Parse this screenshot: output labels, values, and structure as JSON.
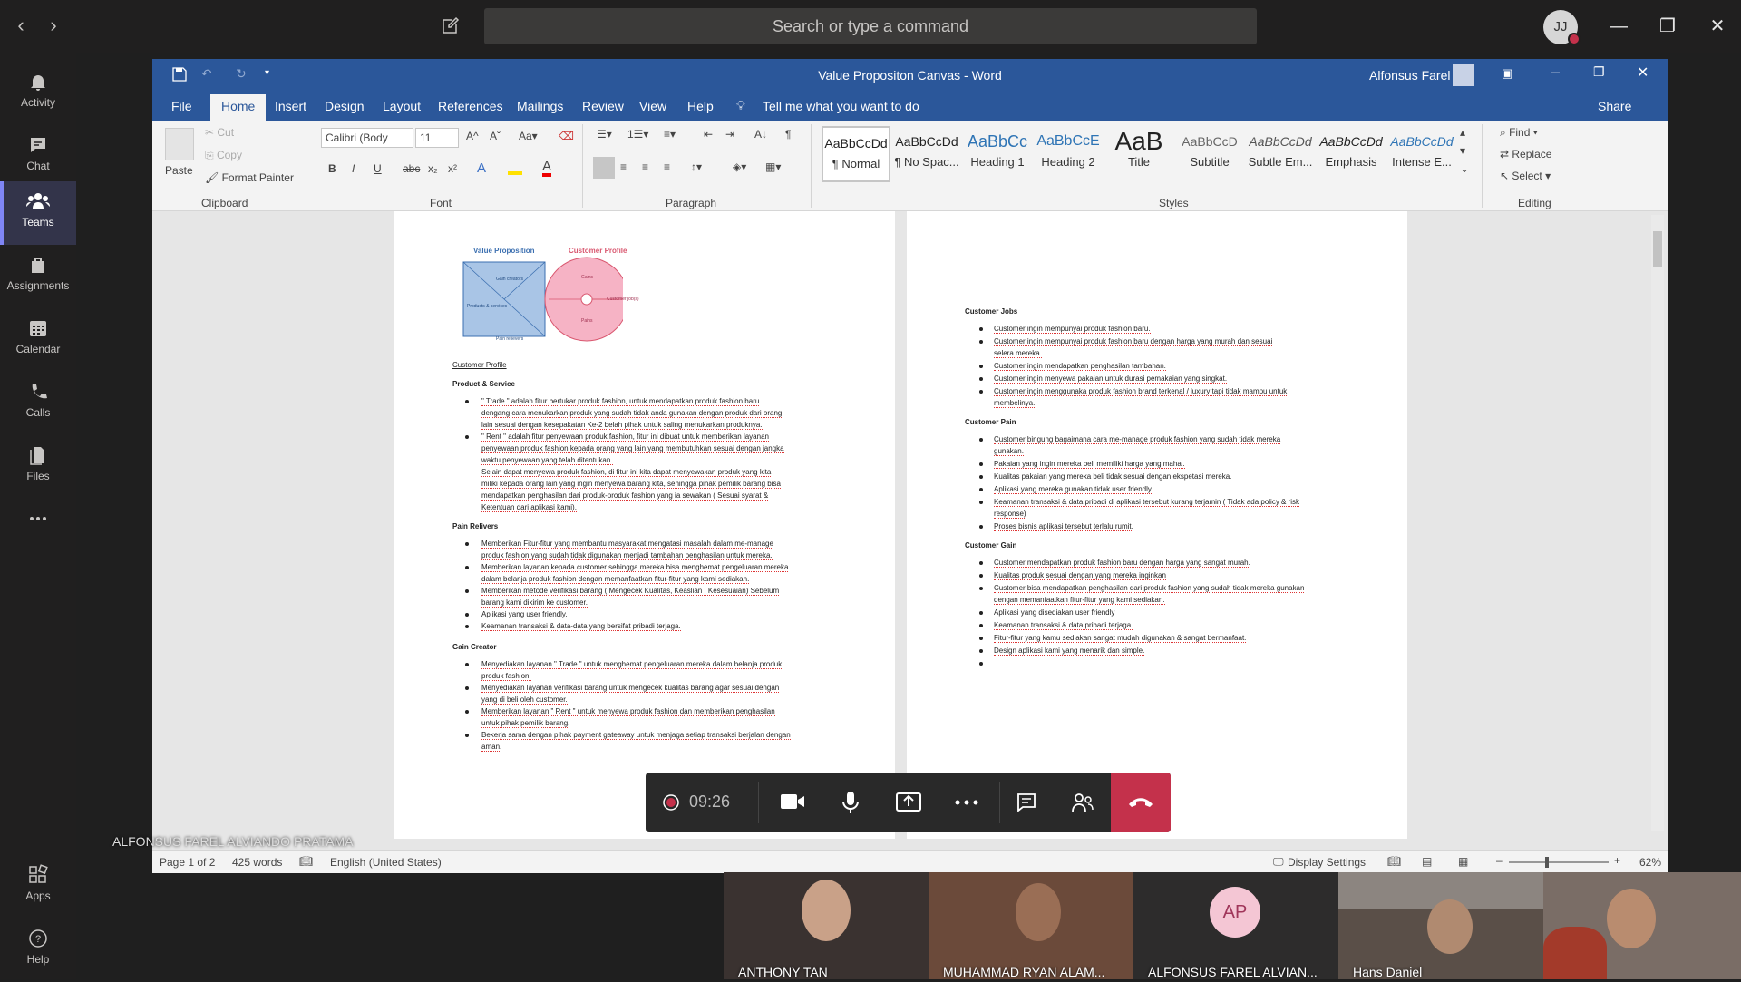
{
  "teams": {
    "search_placeholder": "Search or type a command",
    "avatar_initials": "JJ",
    "rail": [
      {
        "label": "Activity",
        "icon": "bell-icon"
      },
      {
        "label": "Chat",
        "icon": "chat-icon"
      },
      {
        "label": "Teams",
        "icon": "teams-icon"
      },
      {
        "label": "Assignments",
        "icon": "assignments-icon"
      },
      {
        "label": "Calendar",
        "icon": "calendar-icon"
      },
      {
        "label": "Calls",
        "icon": "phone-icon"
      },
      {
        "label": "Files",
        "icon": "files-icon"
      },
      {
        "label": "",
        "icon": "more-icon"
      }
    ],
    "rail_bottom": [
      {
        "label": "Apps",
        "icon": "apps-icon"
      },
      {
        "label": "Help",
        "icon": "help-icon"
      }
    ],
    "accent": "#7f85f5"
  },
  "word": {
    "title": "Value Propositon Canvas - Word",
    "user": "Alfonsus Farel",
    "tabs": [
      "File",
      "Home",
      "Insert",
      "Design",
      "Layout",
      "References",
      "Mailings",
      "Review",
      "View",
      "Help"
    ],
    "tell_me": "Tell me what you want to do",
    "share": "Share",
    "clipboard": {
      "paste": "Paste",
      "cut": "Cut",
      "copy": "Copy",
      "format_painter": "Format Painter",
      "group": "Clipboard"
    },
    "font": {
      "name": "Calibri (Body",
      "size": "11",
      "group": "Font"
    },
    "paragraph_group": "Paragraph",
    "styles": [
      {
        "preview": "AaBbCcDd",
        "name": "¶ Normal"
      },
      {
        "preview": "AaBbCcDd",
        "name": "¶ No Spac..."
      },
      {
        "preview": "AaBbCc",
        "name": "Heading 1"
      },
      {
        "preview": "AaBbCcE",
        "name": "Heading 2"
      },
      {
        "preview": "AaB",
        "name": "Title"
      },
      {
        "preview": "AaBbCcD",
        "name": "Subtitle"
      },
      {
        "preview": "AaBbCcDd",
        "name": "Subtle Em..."
      },
      {
        "preview": "AaBbCcDd",
        "name": "Emphasis"
      },
      {
        "preview": "AaBbCcDd",
        "name": "Intense E..."
      }
    ],
    "styles_group": "Styles",
    "editing": {
      "find": "Find",
      "replace": "Replace",
      "select": "Select",
      "group": "Editing"
    },
    "brand_color": "#2b579a",
    "status": {
      "page": "Page 1 of 2",
      "words": "425 words",
      "language": "English (United States)",
      "display": "Display Settings",
      "zoom": "62%"
    }
  },
  "doc": {
    "canvas": {
      "vp_title": "Value Proposition",
      "cp_title": "Customer Profile",
      "gain_creators": "Gain creators",
      "products": "Products & services",
      "pain_relievers": "Pain relievers",
      "gains": "Gains",
      "pains": "Pains",
      "customer_jobs": "Customer job(s)"
    },
    "left": {
      "customer_profile": "Customer Profile",
      "product_service": "Product & Service",
      "ps_items": [
        "\" Trade \" adalah fitur bertukar produk fashion, untuk mendapatkan produk fashion baru",
        "dengang cara menukarkan produk yang sudah tidak anda gunakan dengan produk dari orang",
        "lain sesuai dengan kesepakatan Ke-2 belah pihak untuk saling menukarkan produknya.",
        "\" Rent \" adalah fitur penyewaan produk fashion, fitur ini dibuat untuk memberikan layanan",
        "penyewaan produk fashion kepada orang yang lain yang membutuhkan sesuai dengan jangka",
        "waktu penyewaan yang telah ditentukan.",
        "Selain dapat menyewa produk fashion, di fitur ini kita dapat menyewakan produk yang kita",
        "miliki kepada orang lain yang ingin menyewa barang kita, sehingga pihak pemilik barang bisa",
        "mendapatkan penghasilan dari produk-produk fashion yang ia sewakan ( Sesuai syarat &",
        "Ketentuan dari aplikasi kami)."
      ],
      "pain_relivers": "Pain Relivers",
      "pr_items": [
        "Memberikan Fitur-fitur yang membantu masyarakat mengatasi masalah dalam me-manage",
        "produk fashion yang sudah tidak digunakan menjadi tambahan penghasilan untuk mereka.",
        "Memberikan layanan kepada customer sehingga mereka bisa menghemat pengeluaran mereka",
        "dalam belanja produk fashion dengan memanfaatkan fitur-fitur yang kami sediakan.",
        "Memberikan metode verifikasi barang ( Mengecek Kualitas, Keaslian , Kesesuaian) Sebelum",
        "barang kami dikirim ke customer.",
        "Aplikasi yang user friendly.",
        "Keamanan transaksi & data-data yang bersifat pribadi terjaga."
      ],
      "gain_creator": "Gain Creator",
      "gc_items": [
        "Menyediakan layanan \" Trade \" untuk menghemat pengeluaran mereka dalam belanja produk",
        "produk fashion.",
        "Menyediakan layanan verifikasi barang untuk mengecek kualitas barang agar sesuai dengan",
        "yang di beli oleh customer.",
        "Memberikan layanan \" Rent \" untuk menyewa produk fashion dan memberikan penghasilan",
        "untuk pihak pemilik barang.",
        "Bekerja sama dengan pihak payment gateaway untuk menjaga setiap transaksi berjalan dengan",
        "aman."
      ]
    },
    "right": {
      "customer_jobs": "Customer Jobs",
      "cj_items": [
        "Customer ingin mempunyai produk fashion baru.",
        "Customer ingin mempunyai produk fashion baru dengan harga yang murah dan sesuai",
        "selera mereka.",
        "Customer ingin mendapatkan penghasilan tambahan.",
        "Customer ingin menyewa pakaian untuk durasi pemakaian yang singkat.",
        "Customer ingin menggunaka produk fashion brand terkenal / luxury tapi tidak mampu untuk",
        "membelinya."
      ],
      "customer_pain": "Customer Pain",
      "cp_items": [
        "Customer bingung bagaimana cara me-manage produk fashion yang sudah tidak mereka",
        "gunakan.",
        "Pakaian yang ingin mereka beli memiliki harga yang mahal.",
        "Kualitas pakaian yang mereka beli tidak sesuai dengan ekspetasi mereka.",
        "Aplikasi yang mereka gunakan tidak user friendly.",
        "Keamanan transaksi & data pribadi di aplikasi tersebut kurang terjamin ( Tidak ada policy & risk",
        "response)",
        "Proses bisnis aplikasi tersebut terlalu rumit."
      ],
      "customer_gain": "Customer Gain",
      "cg_items": [
        "Customer mendapatkan produk fashion baru dengan harga yang sangat murah.",
        "Kualitas produk sesuai dengan yang mereka inginkan",
        "Customer bisa mendapatkan penghasilan dari produk fashion yang sudah tidak mereka gunakan",
        "dengan memanfaatkan fitur-fitur yang kami sediakan.",
        "Aplikasi yang disediakan user friendly",
        "Keamanan transaksi & data pribadi terjaga.",
        "Fitur-fitur yang kamu sediakan sangat mudah digunakan & sangat bermanfaat.",
        "Design aplikasi kami yang menarik dan simple.",
        ""
      ]
    }
  },
  "call": {
    "timer": "09:26",
    "presenter": "ALFONSUS FAREL ALVIANDO PRATAMA"
  },
  "participants": [
    {
      "name": "ANTHONY TAN",
      "bg": "#3a3230"
    },
    {
      "name": "MUHAMMAD RYAN ALAM...",
      "bg": "#6b4a3a"
    },
    {
      "name": "ALFONSUS FAREL ALVIAN...",
      "bg": "#2d2c2c",
      "initials": "AP"
    },
    {
      "name": "Hans Daniel",
      "bg": "#5a4f48"
    },
    {
      "name": "",
      "bg": "#7a6d66"
    }
  ]
}
